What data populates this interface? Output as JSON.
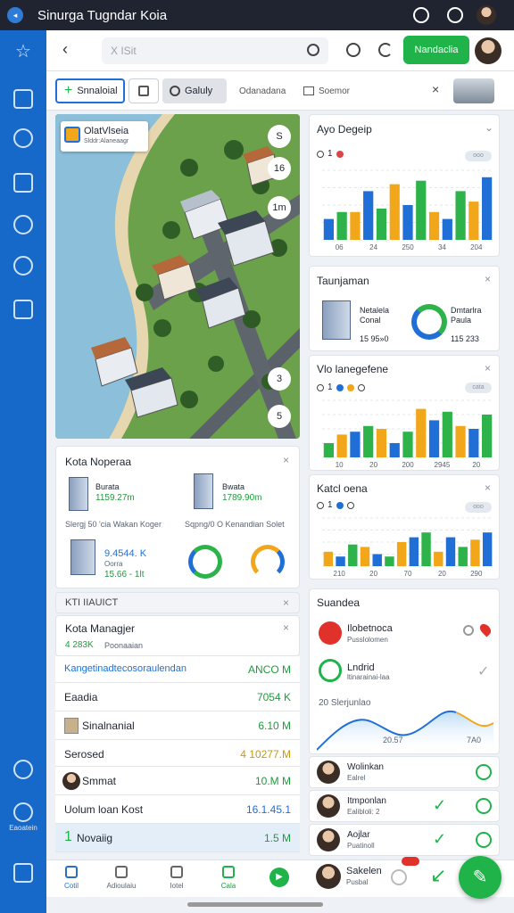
{
  "window": {
    "title": "Sinurga Tugndar Koia"
  },
  "sidebar": {
    "bottom_label": "Eaoatein"
  },
  "topbar": {
    "search_placeholder": "X ISit",
    "action_button": "Nandaclia"
  },
  "toolbar": {
    "primary": "Snnaloial",
    "secondary": "Galuly",
    "link1": "Odanadana",
    "link2": "Soemor"
  },
  "map": {
    "label_title": "OlatVlseia",
    "label_sub": "Slddr:Alaneaagr",
    "zoom_badges": [
      "S",
      "16",
      "1m",
      "3",
      "5"
    ]
  },
  "city_panel": {
    "title": "Kota Noperaa",
    "stat1": {
      "name": "Burata",
      "value": "1159.27m"
    },
    "stat2": {
      "name": "Bwata",
      "value": "1789.90m"
    },
    "caption1": "Slergj 50 'cia Wakan Koger",
    "caption2": "Sqpng/0 O Kenandian Solet",
    "stat3": {
      "value": "9.4544. K",
      "note": "Oorra",
      "delta": "15.66 - 1lt"
    }
  },
  "list_panel": {
    "header": "KTI IIAUICT",
    "title": "Kota Managjer",
    "subtitle_value": "4 283K",
    "subtitle_text": "Poonaaian",
    "rows": [
      {
        "label": "Kangetinadtecosoraulendan",
        "value": "ANCO M"
      },
      {
        "label": "Eaadia",
        "value": "7054 K"
      },
      {
        "label": "Sinalnanial",
        "value": "6.10 M"
      },
      {
        "label": "Serosed",
        "value": "4 10277.M"
      },
      {
        "label": "Smmat",
        "value": "10.M M"
      },
      {
        "label": "Uolum loan Kost",
        "value": "16.1.45.1"
      },
      {
        "label": "Novaiig",
        "value": "1.5 M",
        "num": "1"
      }
    ]
  },
  "chart1": {
    "title": "Ayo Degeip",
    "legend": "1",
    "pill": "ooo",
    "xlabels": [
      "06",
      "24",
      "250",
      "34",
      "204"
    ]
  },
  "tank_panel": {
    "title": "Taunjaman",
    "left": {
      "l1": "Netalela",
      "l2": "Conal",
      "l3": "15 95»0"
    },
    "right": {
      "l1": "Dmtarlra",
      "l2": "Paula",
      "l3": "115 233"
    }
  },
  "chart2": {
    "title": "Vlo lanegefene",
    "legend": "1",
    "pill": "cata",
    "xlabels": [
      "10",
      "20",
      "200",
      "2945",
      "20"
    ]
  },
  "chart3": {
    "title": "Katcl oena",
    "legend": "1",
    "pill": "ooo",
    "xlabels": [
      "210",
      "20",
      "70",
      "20",
      "290"
    ]
  },
  "chart_data": [
    {
      "type": "bar",
      "title": "Ayo Degeip",
      "categories": [
        "06",
        "24",
        "250",
        "34",
        "204"
      ],
      "series": [
        {
          "values": [
            6,
            8,
            8,
            14,
            9,
            16,
            10,
            17,
            8,
            6,
            14,
            11,
            18
          ]
        }
      ],
      "ylim": [
        0,
        20
      ]
    },
    {
      "type": "bar",
      "title": "Vlo lanegefene",
      "categories": [
        "10",
        "20",
        "200",
        "2945",
        "20"
      ],
      "series": [
        {
          "values": [
            5,
            8,
            9,
            11,
            10,
            5,
            9,
            17,
            13,
            16,
            11,
            10,
            15
          ]
        }
      ],
      "ylim": [
        0,
        20
      ]
    },
    {
      "type": "bar",
      "title": "Katcl oena",
      "categories": [
        "210",
        "20",
        "70",
        "20",
        "290"
      ],
      "series": [
        {
          "values": [
            6,
            4,
            9,
            8,
            5,
            4,
            10,
            12,
            14,
            6,
            12,
            8,
            11,
            14
          ]
        }
      ],
      "ylim": [
        0,
        20
      ]
    }
  ],
  "social_panel": {
    "title": "Suandea",
    "item1": {
      "name": "Ilobetnoca",
      "sub": "Pusslolomen"
    },
    "item2": {
      "name": "Lndrid",
      "sub": "ltinarainai-laa"
    },
    "spark_title": "20 Slerjunlao",
    "spark_l1": "20.57",
    "spark_l2": "7A0"
  },
  "people": [
    {
      "name": "Wolinkan",
      "sub": "Ealrel"
    },
    {
      "name": "Itmponlan",
      "sub": "Ealibloli: 2"
    },
    {
      "name": "Aojlar",
      "sub": "Puatinoll"
    }
  ],
  "bottom_nav": {
    "items": [
      "Cotil",
      "Adioulaiu",
      "Iotel",
      "Cala"
    ],
    "user": {
      "name": "Sakelen",
      "sub": "Pusbal"
    }
  },
  "colors": {
    "sidebar": "#1769c9",
    "accent_green": "#1fb34a",
    "bar_blue": "#1f6fd6",
    "bar_green": "#2db34a",
    "bar_orange": "#f2a71b"
  }
}
